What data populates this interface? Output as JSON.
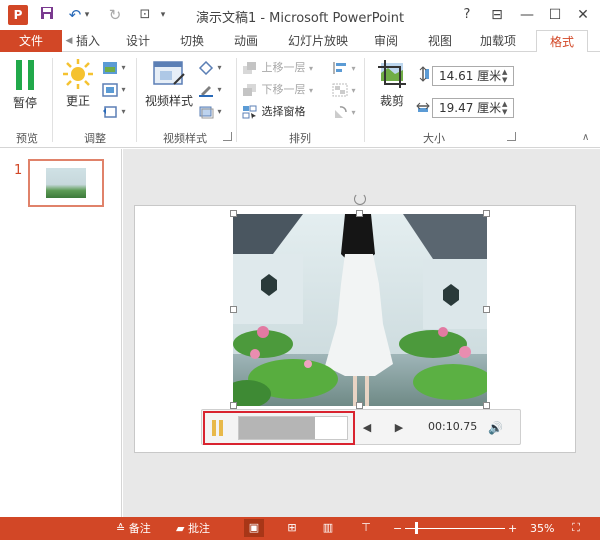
{
  "app": {
    "title": "演示文稿1 - Microsoft PowerPoint",
    "icon_letter": "P",
    "window_controls": {
      "help": "?",
      "ribbon": "⊟",
      "minimize": "—",
      "restore": "☐",
      "close": "✕"
    }
  },
  "quick_access": {
    "save": "💾",
    "undo": "↶",
    "undo_menu": "▾",
    "redo": "↻",
    "present": "⊡",
    "customize": "▾"
  },
  "tabs": {
    "file": "文件",
    "scroll_left": "◀",
    "items": [
      "插入",
      "设计",
      "切换",
      "动画",
      "幻灯片放映",
      "审阅",
      "视图",
      "加载项",
      "格式"
    ],
    "active": "格式"
  },
  "ribbon": {
    "preview": {
      "pause_label": "暂停",
      "group": "预览"
    },
    "adjust": {
      "correct_label": "更正",
      "group": "调整"
    },
    "video_styles": {
      "styles_label": "视频样式",
      "group": "视频样式"
    },
    "arrange": {
      "bring_forward": "上移一层",
      "send_backward": "下移一层",
      "selection_pane": "选择窗格",
      "group": "排列"
    },
    "size": {
      "crop_label": "裁剪",
      "height_value": "14.61 厘米",
      "width_value": "19.47 厘米",
      "group": "大小"
    }
  },
  "thumbnails": {
    "slide_number": "1"
  },
  "video_controls": {
    "time": "00:10.75",
    "progress": 0.7,
    "back_icon": "◀",
    "forward_icon": "▶",
    "volume_icon": "🔊"
  },
  "statusbar": {
    "notes": "备注",
    "comments": "批注",
    "zoom_minus": "−",
    "zoom_plus": "+",
    "zoom": "35%",
    "accent": "#d24726"
  }
}
